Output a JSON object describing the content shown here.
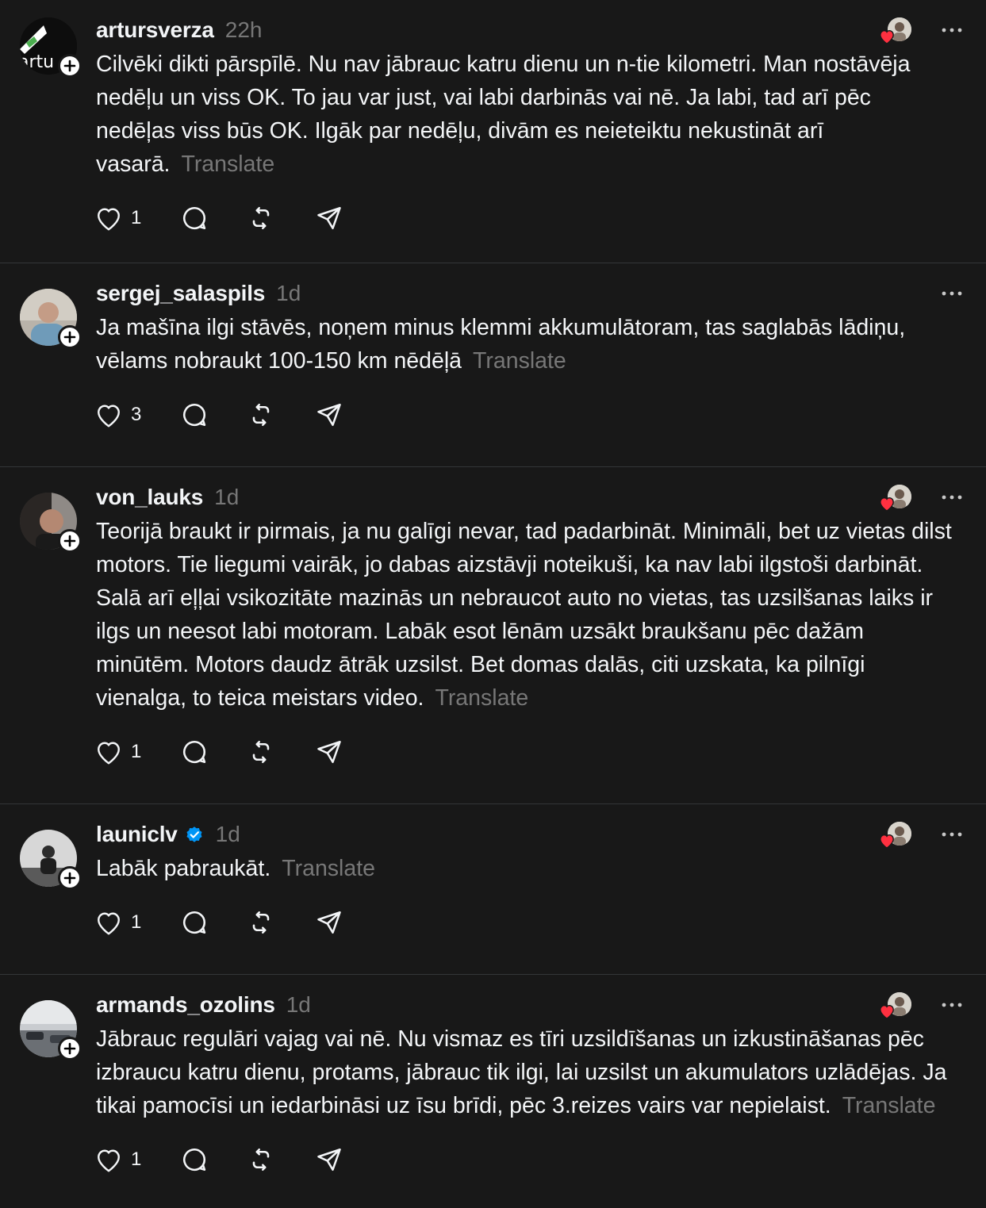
{
  "posts": [
    {
      "username": "artursverza",
      "verified": false,
      "time": "22h",
      "avatar_text": "artu",
      "has_reactors": true,
      "text": "Cilvēki dikti pārspīlē. Nu nav jābrauc katru dienu un n-tie kilometri. Man nostāvēja nedēļu un viss OK. To jau var just, vai labi darbinās vai nē. Ja labi, tad arī pēc nedēļas viss būs OK. Ilgāk par nedēļu, divām es neieteiktu nekustināt arī vasarā.",
      "translate_label": "Translate",
      "likes": "1"
    },
    {
      "username": "sergej_salaspils",
      "verified": false,
      "time": "1d",
      "has_reactors": false,
      "text": "Ja mašīna ilgi stāvēs, noņem minus klemmi akkumulātoram, tas saglabās lādiņu, vēlams nobraukt 100-150 km nēdēļā",
      "translate_label": "Translate",
      "likes": "3"
    },
    {
      "username": "von_lauks",
      "verified": false,
      "time": "1d",
      "has_reactors": true,
      "text": "Teorijā braukt ir pirmais, ja nu galīgi nevar, tad padarbināt. Minimāli, bet uz vietas dilst motors. Tie liegumi vairāk, jo dabas aizstāvji noteikuši, ka nav labi ilgstoši darbināt. Salā arī eļļai vsikozitāte mazinās un nebraucot auto no vietas, tas uzsilšanas laiks ir ilgs un neesot labi motoram. Labāk esot lēnām uzsākt braukšanu pēc dažām minūtēm. Motors daudz ātrāk uzsilst. Bet domas dalās, citi uzskata, ka pilnīgi vienalga, to teica meistars video.",
      "translate_label": "Translate",
      "likes": "1"
    },
    {
      "username": "launiclv",
      "verified": true,
      "time": "1d",
      "has_reactors": true,
      "text": "Labāk pabraukāt.",
      "translate_label": "Translate",
      "likes": "1"
    },
    {
      "username": "armands_ozolins",
      "verified": false,
      "time": "1d",
      "has_reactors": true,
      "text": "Jābrauc regulāri vajag vai nē. Nu vismaz es tīri uzsildīšanas un izkustināšanas pēc izbraucu katru dienu, protams, jābrauc tik ilgi, lai uzsilst un akumulators uzlādējas. Ja tikai pamocīsi un iedarbināsi uz īsu brīdi, pēc 3.reizes vairs var nepielaist.",
      "translate_label": "Translate",
      "likes": "1"
    }
  ],
  "colors": {
    "background": "#181818",
    "text": "#f3f5f7",
    "muted": "#777777",
    "divider": "#333638",
    "heart": "#ff3040",
    "verified": "#0095f6"
  },
  "icons": {
    "like": "heart-outline-icon",
    "reply": "speech-bubble-icon",
    "repost": "repost-arrows-icon",
    "share": "paper-plane-icon",
    "more": "more-dots-icon",
    "follow": "plus-icon",
    "verified": "verified-badge-icon"
  }
}
